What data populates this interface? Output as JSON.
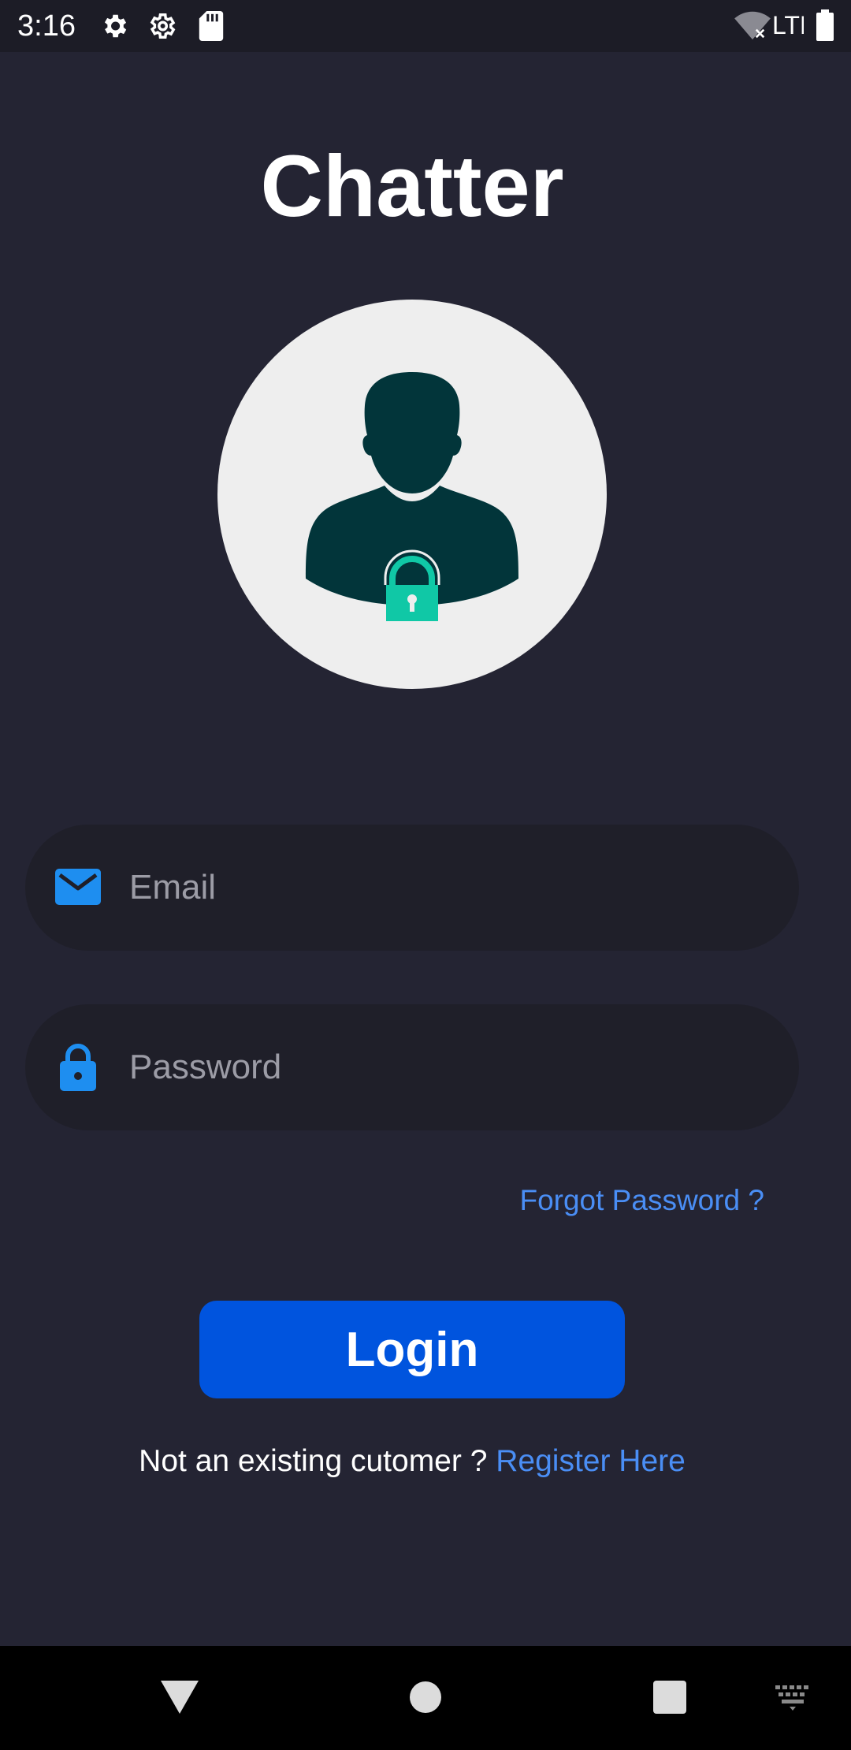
{
  "status_bar": {
    "time": "3:16",
    "network": "LTE",
    "icons": [
      "gear-icon",
      "settings-icon",
      "sd-card-icon",
      "wifi-off-icon",
      "battery-icon"
    ]
  },
  "app": {
    "title": "Chatter"
  },
  "avatar": {
    "icon": "user-lock-icon"
  },
  "login_form": {
    "email": {
      "placeholder": "Email",
      "value": "",
      "icon": "mail-icon"
    },
    "password": {
      "placeholder": "Password",
      "value": "",
      "icon": "lock-icon"
    },
    "forgot_password": "Forgot Password ?",
    "login_label": "Login",
    "register_prompt": "Not an existing cutomer ?",
    "register_link": "Register Here"
  },
  "nav_bar": {
    "buttons": [
      "back-icon",
      "home-icon",
      "recents-icon",
      "keyboard-icon"
    ]
  },
  "colors": {
    "background": "#242433",
    "field_background": "#1f1f29",
    "primary": "#0054de",
    "link": "#4a8ef5",
    "icon_blue": "#1e8ef0",
    "avatar_bg": "#eeeeee",
    "person": "#02353a",
    "lock_accent": "#10c8a6"
  }
}
